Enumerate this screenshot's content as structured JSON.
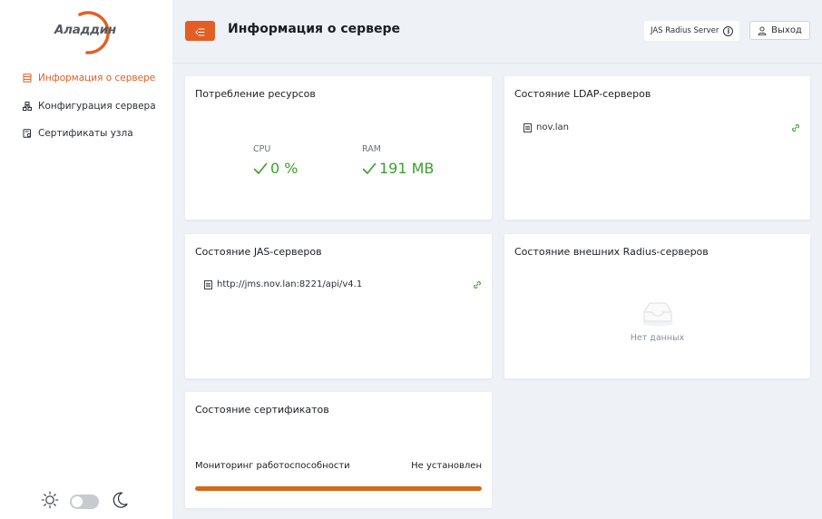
{
  "brand": {
    "logo_text": "Аладдин",
    "accent": "#e35e24"
  },
  "sidebar": {
    "items": [
      {
        "label": "Информация о сервере",
        "icon": "server-info-icon",
        "active": true
      },
      {
        "label": "Конфигурация сервера",
        "icon": "network-config-icon",
        "active": false
      },
      {
        "label": "Сертификаты узла",
        "icon": "certificate-icon",
        "active": false
      }
    ],
    "theme": {
      "light_icon": "sun-icon",
      "dark_icon": "moon-icon",
      "dark_mode": false
    }
  },
  "header": {
    "menu_icon": "menu-collapse-icon",
    "title": "Информация о сервере",
    "server_name": "JAS Radius Server",
    "info_icon": "info-icon",
    "logout_label": "Выход",
    "logout_icon": "user-icon"
  },
  "cards": {
    "resources": {
      "title": "Потребление ресурсов",
      "cpu_label": "CPU",
      "cpu_value": "0 %",
      "ram_label": "RAM",
      "ram_value": "191 MB",
      "ok_color": "#3aa02c"
    },
    "ldap": {
      "title": "Состояние LDAP-серверов",
      "servers": [
        {
          "name": "nov.lan"
        }
      ]
    },
    "jas": {
      "title": "Состояние JAS-серверов",
      "servers": [
        {
          "name": "http://jms.nov.lan:8221/api/v4.1"
        }
      ]
    },
    "radius": {
      "title": "Состояние внешних Radius-серверов",
      "empty_text": "Нет данных"
    },
    "certs": {
      "title": "Состояние сертификатов",
      "row_label": "Мониторинг работоспособности",
      "row_value": "Не установлен",
      "bar_color": "#d36a1a",
      "bar_fraction": 1.0
    }
  }
}
